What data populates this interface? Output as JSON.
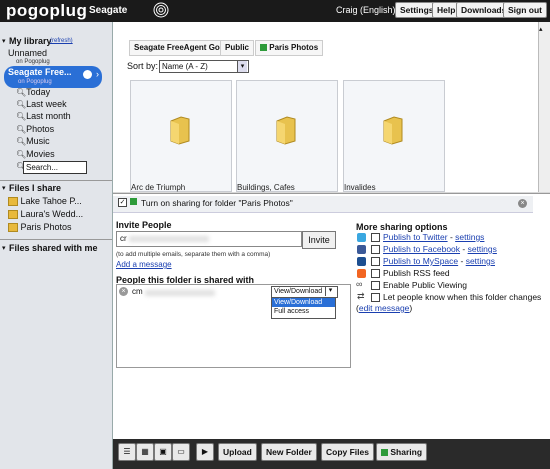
{
  "topbar": {
    "logo": "pogoplug",
    "brand": "Seagate",
    "user": "Craig (English)",
    "buttons": [
      "Settings",
      "Help",
      "Downloads",
      "Sign out"
    ]
  },
  "sidebar": {
    "my_library": "My library",
    "refresh": "(refresh)",
    "unnamed": "Unnamed",
    "on_pogoplug": "on Pogoplug",
    "selected_device": "Seagate Free...",
    "selected_sub": "on Pogoplug",
    "filters": [
      "Today",
      "Last week",
      "Last month",
      "Photos",
      "Music",
      "Movies"
    ],
    "search_placeholder": "Search...",
    "files_i_share": "Files I share",
    "shared_items": [
      "Lake Tahoe P...",
      "Laura's Wedd...",
      "Paris Photos"
    ],
    "files_shared_with_me": "Files shared with me"
  },
  "breadcrumb": [
    "Seagate FreeAgent Go",
    "Public",
    "Paris Photos"
  ],
  "sort": {
    "label": "Sort by:",
    "value": "Name (A - Z)"
  },
  "folders": [
    "Arc de Triumph",
    "Buildings, Cafes",
    "Invalides"
  ],
  "sharing": {
    "turn_on_label": "Turn on sharing for folder \"Paris Photos\"",
    "invite_heading": "Invite People",
    "invite_value": "cr",
    "invite_button": "Invite",
    "hint": "(to add multiple emails, separate them with a comma)",
    "add_message": "Add a message",
    "shared_with_heading": "People this folder is shared with",
    "shared_email": "cm",
    "access_value": "View/Download",
    "access_options": [
      "View/Download",
      "Full access"
    ],
    "more_heading": "More sharing options",
    "options": [
      {
        "text": "Publish to Twitter",
        "settings": "settings",
        "icon": "twitter-icon",
        "color": "#3aa7e0"
      },
      {
        "text": "Publish to Facebook",
        "settings": "settings",
        "icon": "facebook-icon",
        "color": "#3b5998"
      },
      {
        "text": "Publish to MySpace",
        "settings": "settings",
        "icon": "myspace-icon",
        "color": "#1d4f91"
      },
      {
        "text": "Publish RSS feed",
        "icon": "rss-icon",
        "color": "#f26522"
      },
      {
        "text": "Enable Public Viewing",
        "icon": "link-icon",
        "color": "#444444"
      },
      {
        "text": "Let people know when this folder changes",
        "icon": "notify-icon",
        "color": "#444444"
      }
    ],
    "edit_message": "edit message"
  },
  "toolbar": {
    "upload": "Upload",
    "new_folder": "New Folder",
    "copy_files": "Copy Files",
    "sharing": "Sharing"
  }
}
